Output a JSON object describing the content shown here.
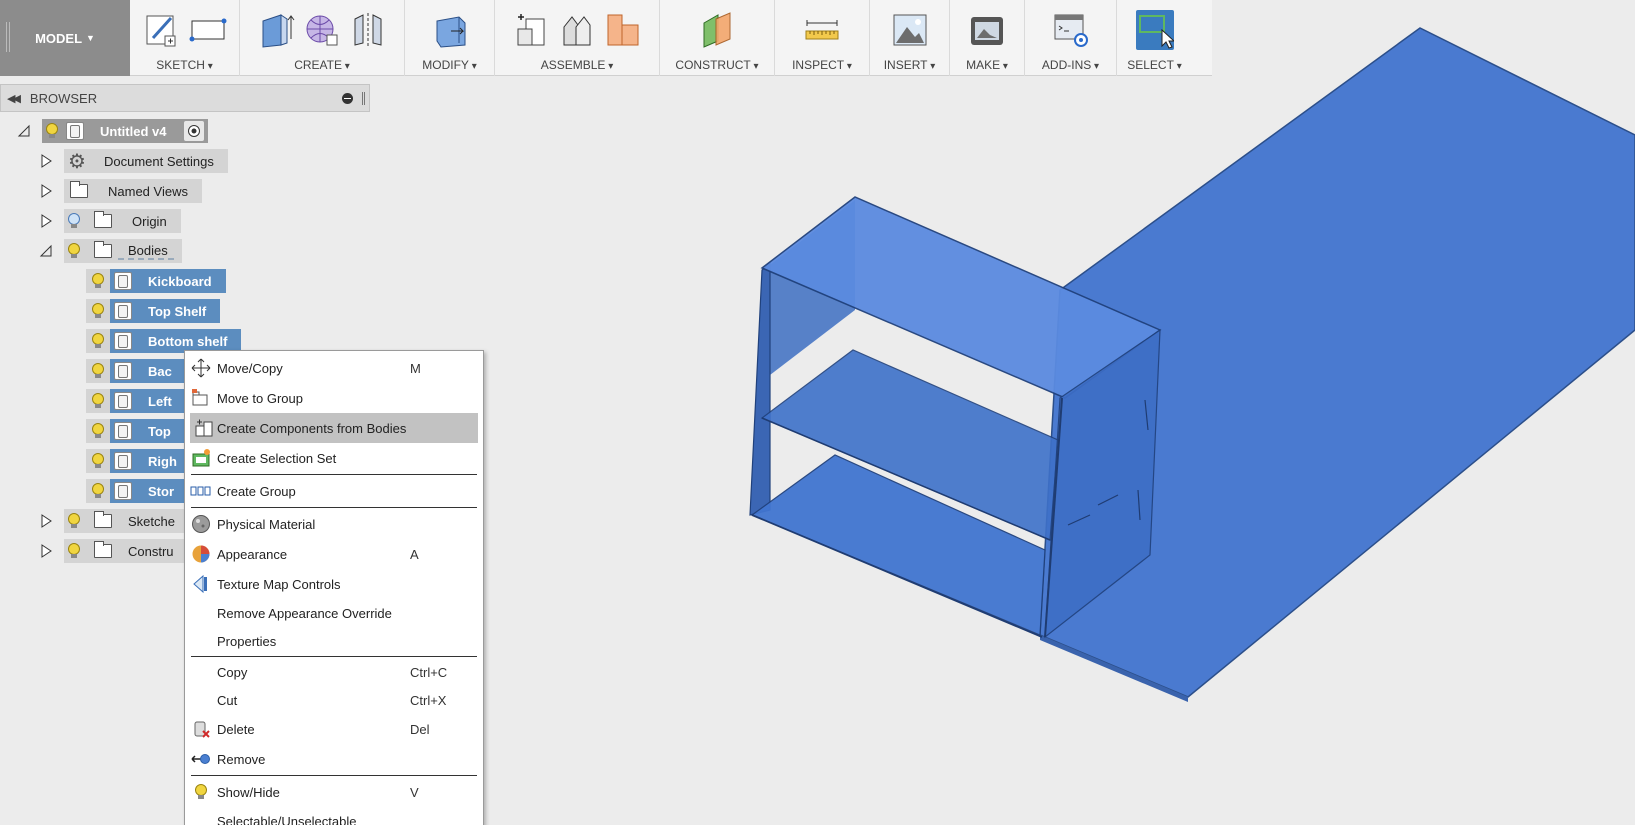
{
  "toolbar": {
    "model_label": "MODEL",
    "groups": [
      {
        "label": "SKETCH"
      },
      {
        "label": "CREATE"
      },
      {
        "label": "MODIFY"
      },
      {
        "label": "ASSEMBLE"
      },
      {
        "label": "CONSTRUCT"
      },
      {
        "label": "INSPECT"
      },
      {
        "label": "INSERT"
      },
      {
        "label": "MAKE"
      },
      {
        "label": "ADD-INS"
      },
      {
        "label": "SELECT"
      }
    ]
  },
  "browser": {
    "title": "BROWSER",
    "root": "Untitled v4",
    "document_settings": "Document Settings",
    "named_views": "Named Views",
    "origin": "Origin",
    "bodies": "Bodies",
    "bodies_items": [
      "Kickboard",
      "Top Shelf",
      "Bottom shelf",
      "Bac",
      "Left",
      "Top",
      "Righ",
      "Stor"
    ],
    "sketches": "Sketche",
    "construction": "Constru"
  },
  "context_menu": {
    "items": [
      {
        "label": "Move/Copy",
        "key": "M"
      },
      {
        "label": "Move to Group",
        "key": ""
      },
      {
        "label": "Create Components from Bodies",
        "key": ""
      },
      {
        "label": "Create Selection Set",
        "key": ""
      },
      {
        "label": "Create Group",
        "key": ""
      },
      {
        "label": "Physical Material",
        "key": ""
      },
      {
        "label": "Appearance",
        "key": "A"
      },
      {
        "label": "Texture Map Controls",
        "key": ""
      },
      {
        "label": "Remove Appearance Override",
        "key": ""
      },
      {
        "label": "Properties",
        "key": ""
      },
      {
        "label": "Copy",
        "key": "Ctrl+C"
      },
      {
        "label": "Cut",
        "key": "Ctrl+X"
      },
      {
        "label": "Delete",
        "key": "Del"
      },
      {
        "label": "Remove",
        "key": ""
      },
      {
        "label": "Show/Hide",
        "key": "V"
      },
      {
        "label": "Selectable/Unselectable",
        "key": ""
      }
    ]
  },
  "colors": {
    "model_blue": "#4a7fd1",
    "selection_blue": "#5c8dbf",
    "highlight": "#c2c2c2"
  }
}
